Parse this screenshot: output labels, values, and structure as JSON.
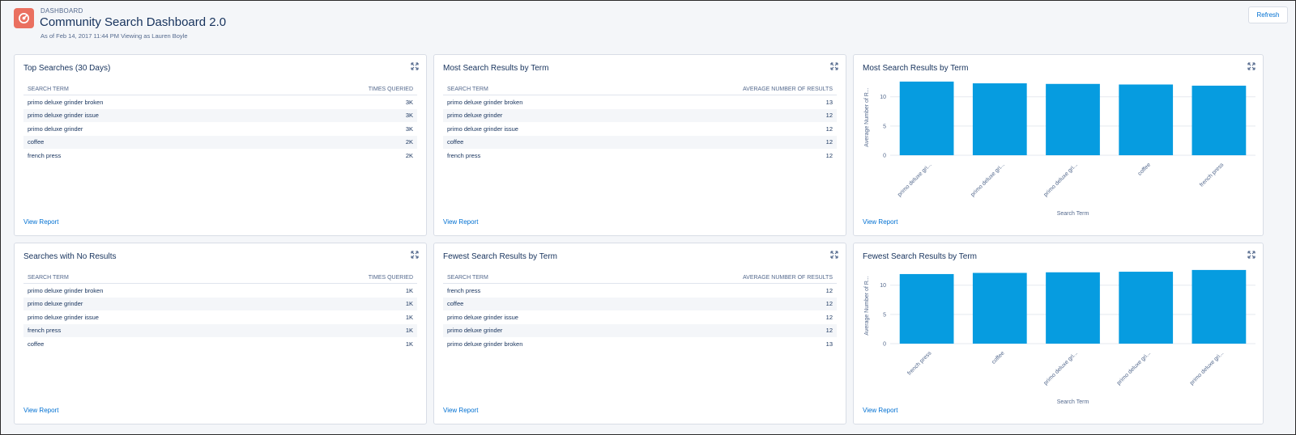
{
  "header": {
    "eyebrow": "DASHBOARD",
    "title": "Community Search Dashboard 2.0",
    "subtitle": "As of Feb 14, 2017 11:44 PM Viewing as Lauren Boyle",
    "refresh_label": "Refresh"
  },
  "colors": {
    "bar": "#069ce0",
    "accent": "#0070d2",
    "logo": "#ea7060"
  },
  "view_report_label": "View Report",
  "panels": {
    "top_searches": {
      "title": "Top Searches (30 Days)",
      "col1": "SEARCH TERM",
      "col2": "TIMES QUERIED",
      "rows": [
        [
          "primo deluxe grinder broken",
          "3K"
        ],
        [
          "primo deluxe grinder issue",
          "3K"
        ],
        [
          "primo deluxe grinder",
          "3K"
        ],
        [
          "coffee",
          "2K"
        ],
        [
          "french press",
          "2K"
        ]
      ]
    },
    "most_results_table": {
      "title": "Most Search Results by Term",
      "col1": "SEARCH TERM",
      "col2": "AVERAGE NUMBER OF RESULTS",
      "rows": [
        [
          "primo deluxe grinder broken",
          "13"
        ],
        [
          "primo deluxe grinder",
          "12"
        ],
        [
          "primo deluxe grinder issue",
          "12"
        ],
        [
          "coffee",
          "12"
        ],
        [
          "french press",
          "12"
        ]
      ]
    },
    "no_results": {
      "title": "Searches with No Results",
      "col1": "SEARCH TERM",
      "col2": "TIMES QUERIED",
      "rows": [
        [
          "primo deluxe grinder broken",
          "1K"
        ],
        [
          "primo deluxe grinder",
          "1K"
        ],
        [
          "primo deluxe grinder issue",
          "1K"
        ],
        [
          "french press",
          "1K"
        ],
        [
          "coffee",
          "1K"
        ]
      ]
    },
    "fewest_results_table": {
      "title": "Fewest Search Results by Term",
      "col1": "SEARCH TERM",
      "col2": "AVERAGE NUMBER OF RESULTS",
      "rows": [
        [
          "french press",
          "12"
        ],
        [
          "coffee",
          "12"
        ],
        [
          "primo deluxe grinder issue",
          "12"
        ],
        [
          "primo deluxe grinder",
          "12"
        ],
        [
          "primo deluxe grinder broken",
          "13"
        ]
      ]
    },
    "most_results_chart": {
      "title": "Most Search Results by Term"
    },
    "fewest_results_chart": {
      "title": "Fewest Search Results by Term"
    }
  },
  "chart_data": [
    {
      "type": "bar",
      "title": "Most Search Results by Term",
      "xlabel": "Search Term",
      "ylabel": "Average Number of R...",
      "categories": [
        "primo deluxe gri...",
        "primo deluxe gri...",
        "primo deluxe gri...",
        "coffee",
        "french press"
      ],
      "values": [
        12.6,
        12.3,
        12.2,
        12.1,
        11.9
      ],
      "yticks": [
        "0",
        "5",
        "10"
      ],
      "ylim": [
        0,
        13
      ]
    },
    {
      "type": "bar",
      "title": "Fewest Search Results by Term",
      "xlabel": "Search Term",
      "ylabel": "Average Number of R...",
      "categories": [
        "french press",
        "coffee",
        "primo deluxe gri...",
        "primo deluxe gri...",
        "primo deluxe gri..."
      ],
      "values": [
        11.9,
        12.1,
        12.2,
        12.3,
        12.6
      ],
      "yticks": [
        "0",
        "5",
        "10"
      ],
      "ylim": [
        0,
        13
      ]
    }
  ]
}
